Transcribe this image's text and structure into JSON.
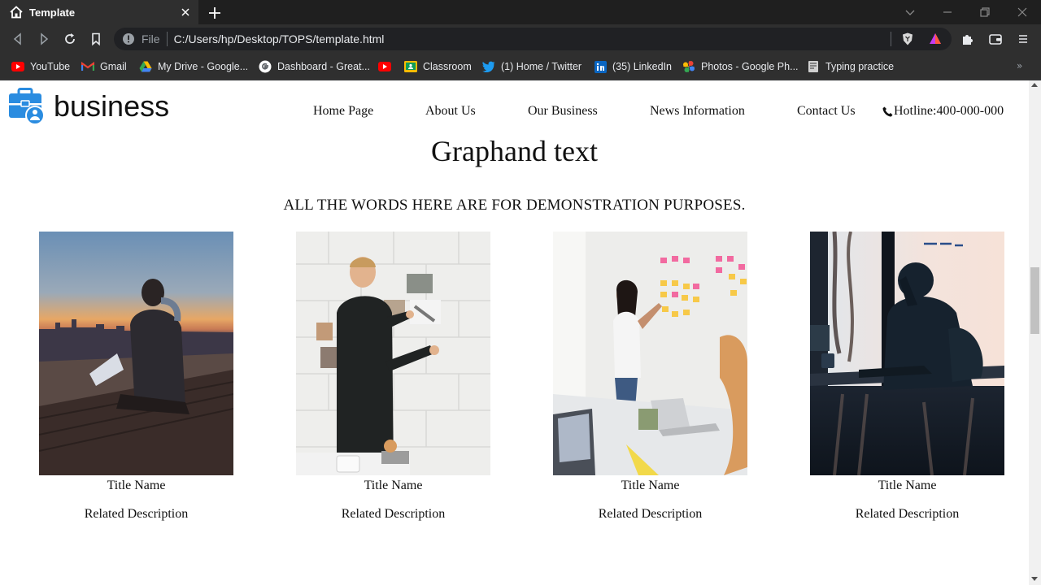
{
  "browser": {
    "tab_title": "Template",
    "url_scheme": "File",
    "url": "C:/Users/hp/Desktop/TOPS/template.html",
    "bookmarks": [
      {
        "label": "YouTube",
        "icon": "youtube-icon"
      },
      {
        "label": "Gmail",
        "icon": "gmail-icon"
      },
      {
        "label": "My Drive - Google...",
        "icon": "google-drive-icon"
      },
      {
        "label": "Dashboard - Great...",
        "icon": "google-g-icon"
      },
      {
        "label": "",
        "icon": "youtube-icon"
      },
      {
        "label": "Classroom",
        "icon": "google-classroom-icon"
      },
      {
        "label": "(1) Home / Twitter",
        "icon": "twitter-icon"
      },
      {
        "label": "(35) LinkedIn",
        "icon": "linkedin-icon"
      },
      {
        "label": "Photos - Google Ph...",
        "icon": "google-photos-icon"
      },
      {
        "label": "Typing practice",
        "icon": "typing-icon"
      }
    ]
  },
  "site": {
    "logo_text": "business",
    "nav": [
      "Home Page",
      "About Us",
      "Our Business",
      "News Information",
      "Contact Us"
    ],
    "hotline": "Hotline:400-000-000",
    "headline": "Graphand text",
    "subline": "ALL THE WORDS HERE ARE FOR DEMONSTRATION PURPOSES.",
    "cards": [
      {
        "title": "Title Name",
        "description": "Related Description",
        "image": "man-laptop-sunset-photo"
      },
      {
        "title": "Title Name",
        "description": "Related Description",
        "image": "man-pinning-photos-wall-photo"
      },
      {
        "title": "Title Name",
        "description": "Related Description",
        "image": "woman-sticky-notes-office-photo"
      },
      {
        "title": "Title Name",
        "description": "Related Description",
        "image": "silhouette-window-cafe-photo"
      }
    ]
  },
  "colors": {
    "chrome_dark": "#1f1f1f",
    "chrome_toolbar": "#2f2f2f",
    "logo_blue": "#2a8ce0",
    "page_text": "#111111"
  }
}
